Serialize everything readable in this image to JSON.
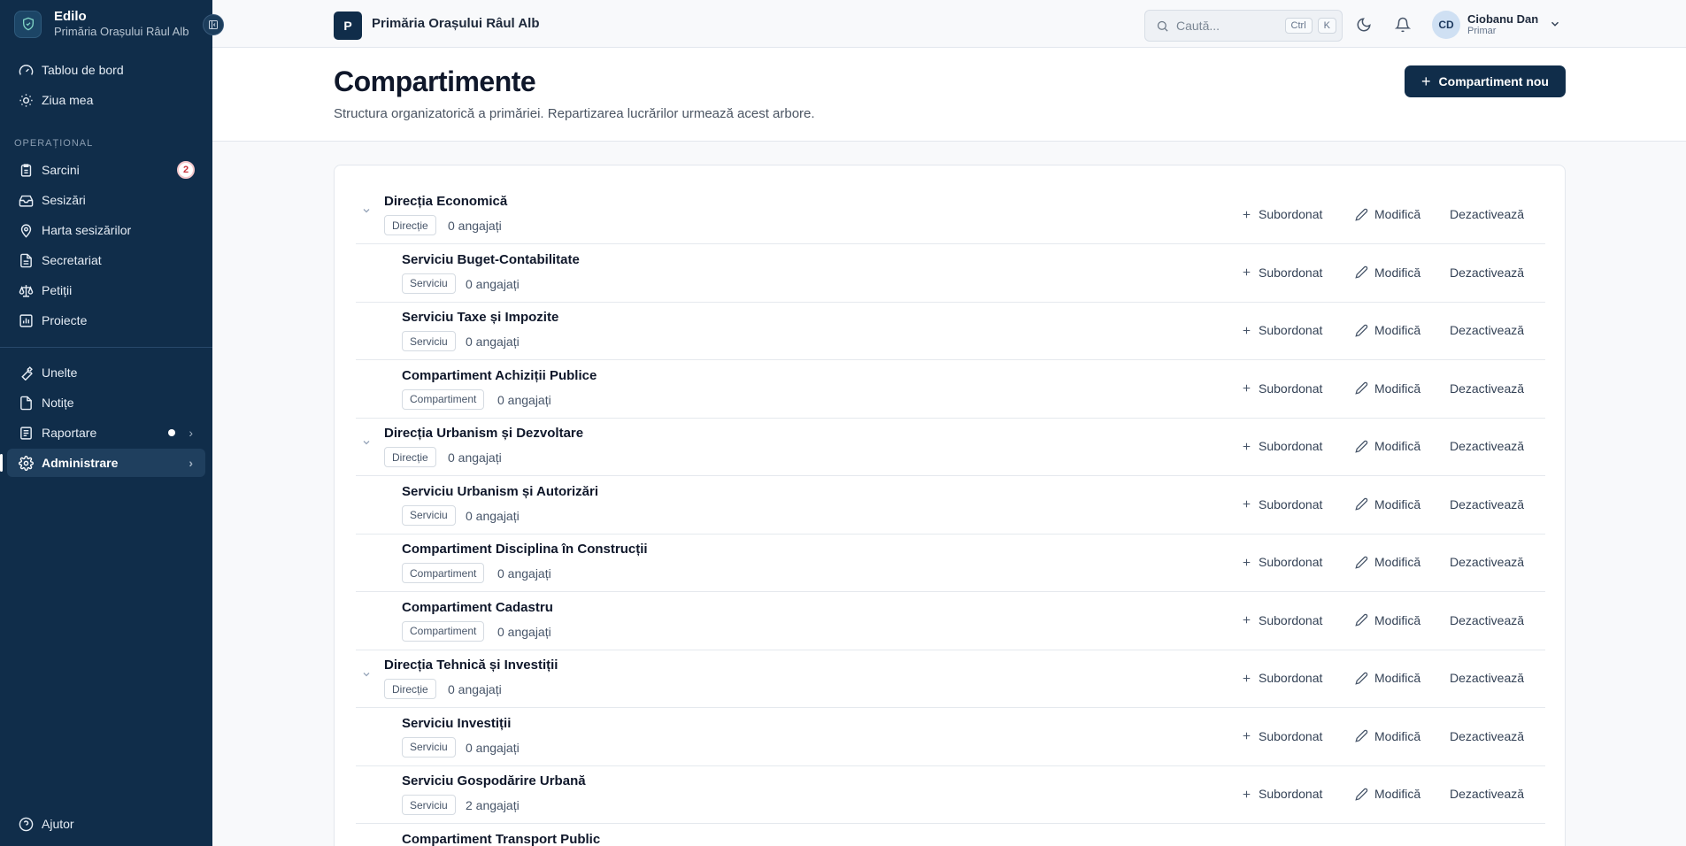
{
  "app": {
    "name": "Edilo",
    "org": "Primăria Orașului Râul Alb"
  },
  "sidebar": {
    "top_items": [
      {
        "label": "Tablou de bord",
        "icon": "gauge-icon"
      },
      {
        "label": "Ziua mea",
        "icon": "sun-icon"
      }
    ],
    "section_label": "Operațional",
    "ops_items": [
      {
        "label": "Sarcini",
        "icon": "clipboard-icon",
        "badge": "2"
      },
      {
        "label": "Sesizări",
        "icon": "inbox-icon"
      },
      {
        "label": "Harta sesizărilor",
        "icon": "map-pin-icon"
      },
      {
        "label": "Secretariat",
        "icon": "file-text-icon"
      },
      {
        "label": "Petiții",
        "icon": "scale-icon"
      },
      {
        "label": "Proiecte",
        "icon": "chart-icon"
      }
    ],
    "tool_items": [
      {
        "label": "Unelte",
        "icon": "wrench-icon"
      },
      {
        "label": "Notițe",
        "icon": "note-icon"
      },
      {
        "label": "Raportare",
        "icon": "report-icon"
      },
      {
        "label": "Administrare",
        "icon": "gear-icon"
      }
    ],
    "help": "Ajutor"
  },
  "topbar": {
    "org_initial": "P",
    "org_name": "Primăria Orașului Râul Alb",
    "search_placeholder": "Caută...",
    "kbd_ctrl": "Ctrl",
    "kbd_k": "K",
    "user_initials": "CD",
    "user_name": "Ciobanu Dan",
    "user_role": "Primar"
  },
  "page": {
    "title": "Compartimente",
    "description": "Structura organizatorică a primăriei. Repartizarea lucrărilor urmează acest arbore.",
    "new_button": "Compartiment nou"
  },
  "actions": {
    "sub": "Subordonat",
    "mod": "Modifică",
    "dez": "Dezactivează"
  },
  "tree": [
    {
      "name": "Direcția Economică",
      "tag": "Direcție",
      "count": "0 angajați",
      "level": 0
    },
    {
      "name": "Serviciu Buget-Contabilitate",
      "tag": "Serviciu",
      "count": "0 angajați",
      "level": 1
    },
    {
      "name": "Serviciu Taxe și Impozite",
      "tag": "Serviciu",
      "count": "0 angajați",
      "level": 1
    },
    {
      "name": "Compartiment Achiziții Publice",
      "tag": "Compartiment",
      "count": "0 angajați",
      "level": 1
    },
    {
      "name": "Direcția Urbanism și Dezvoltare",
      "tag": "Direcție",
      "count": "0 angajați",
      "level": 0
    },
    {
      "name": "Serviciu Urbanism și Autorizări",
      "tag": "Serviciu",
      "count": "0 angajați",
      "level": 1
    },
    {
      "name": "Compartiment Disciplina în Construcții",
      "tag": "Compartiment",
      "count": "0 angajați",
      "level": 1
    },
    {
      "name": "Compartiment Cadastru",
      "tag": "Compartiment",
      "count": "0 angajați",
      "level": 1
    },
    {
      "name": "Direcția Tehnică și Investiții",
      "tag": "Direcție",
      "count": "0 angajați",
      "level": 0
    },
    {
      "name": "Serviciu Investiții",
      "tag": "Serviciu",
      "count": "0 angajați",
      "level": 1
    },
    {
      "name": "Serviciu Gospodărire Urbană",
      "tag": "Serviciu",
      "count": "2 angajați",
      "level": 1
    },
    {
      "name": "Compartiment Transport Public",
      "tag": "",
      "count": "",
      "level": 1
    }
  ]
}
